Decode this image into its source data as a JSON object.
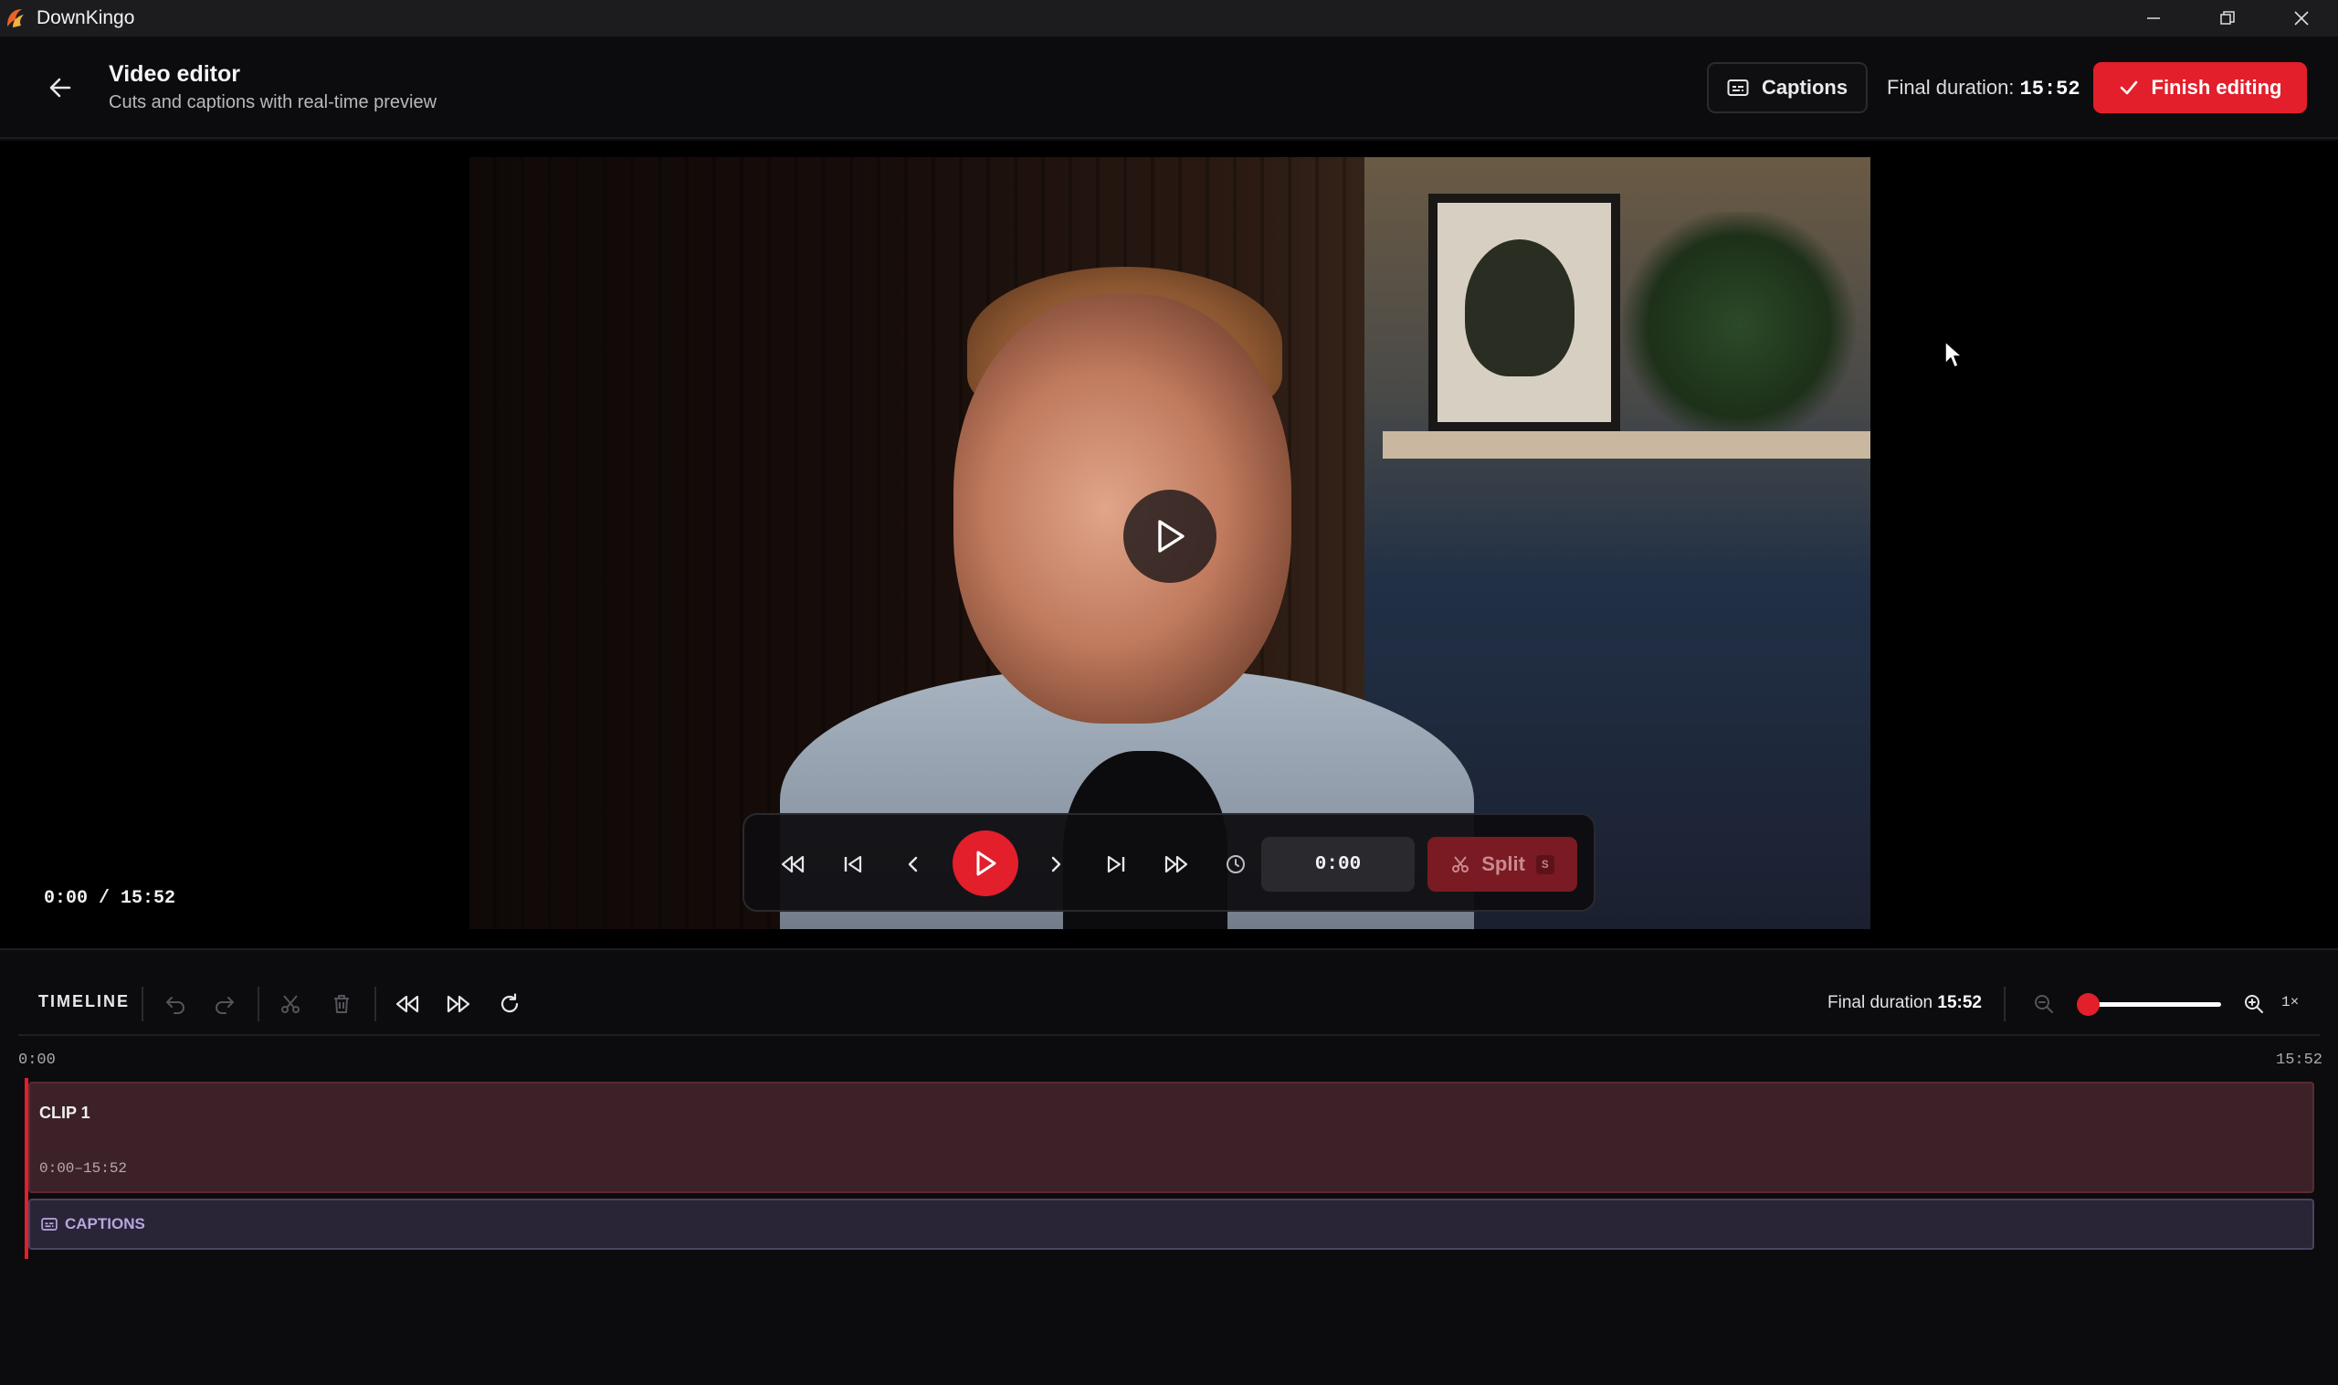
{
  "window": {
    "app_name": "DownKingo"
  },
  "header": {
    "title": "Video editor",
    "subtitle": "Cuts and captions with real-time preview",
    "captions_label": "Captions",
    "final_duration_label": "Final duration:",
    "final_duration_value": "15:52",
    "finish_label": "Finish editing"
  },
  "player": {
    "time_readout": "0:00 / 15:52",
    "time_input_value": "0:00",
    "split_label": "Split",
    "split_shortcut": "S"
  },
  "timeline": {
    "label": "TIMELINE",
    "final_duration_label": "Final duration",
    "final_duration_value": "15:52",
    "zoom_label": "1×",
    "zoom_level": 0,
    "ruler_start": "0:00",
    "ruler_end": "15:52",
    "clips": [
      {
        "name": "CLIP 1",
        "range": "0:00–15:52"
      }
    ],
    "captions_track_label": "CAPTIONS"
  },
  "colors": {
    "accent": "#e21f2b",
    "clip_fill": "#3c2228",
    "captions_fill": "#2a2437",
    "background": "#0c0b0e"
  }
}
